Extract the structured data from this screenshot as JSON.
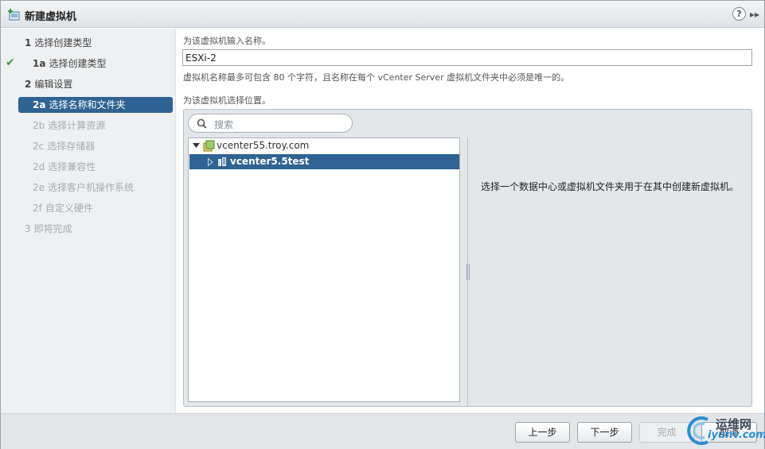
{
  "window": {
    "title": "新建虚拟机",
    "help_label": "?",
    "expand_label": "▸▸"
  },
  "nav": {
    "steps": [
      {
        "num": "1",
        "label": "选择创建类型",
        "state": "normal"
      },
      {
        "num": "1a",
        "label": "选择创建类型",
        "state": "completed"
      },
      {
        "num": "2",
        "label": "编辑设置",
        "state": "normal"
      },
      {
        "num": "2a",
        "label": "选择名称和文件夹",
        "state": "active"
      },
      {
        "num": "2b",
        "label": "选择计算资源",
        "state": "disabled"
      },
      {
        "num": "2c",
        "label": "选择存储器",
        "state": "disabled"
      },
      {
        "num": "2d",
        "label": "选择兼容性",
        "state": "disabled"
      },
      {
        "num": "2e",
        "label": "选择客户机操作系统",
        "state": "disabled"
      },
      {
        "num": "2f",
        "label": "自定义硬件",
        "state": "disabled"
      },
      {
        "num": "3",
        "label": "即将完成",
        "state": "disabled"
      }
    ]
  },
  "content": {
    "name_prompt": "为该虚拟机输入名称。",
    "name_value": "ESXi-2",
    "name_hint": "虚拟机名称最多可包含 80 个字符，且名称在每个 vCenter Server 虚拟机文件夹中必须是唯一的。",
    "location_prompt": "为该虚拟机选择位置。",
    "search_placeholder": "搜索",
    "tree": [
      {
        "label": "vcenter55.troy.com",
        "expanded": true,
        "icon": "vcenter-icon"
      },
      {
        "label": "vcenter5.5test",
        "expanded": false,
        "selected": true,
        "icon": "datacenter-icon"
      }
    ],
    "info_text": "选择一个数据中心或虚拟机文件夹用于在其中创建新虚拟机。"
  },
  "footer": {
    "back_label": "上一步",
    "next_label": "下一步",
    "finish_label": "完成",
    "cancel_label": "取消"
  },
  "watermark": {
    "line1": "运维网",
    "line2": "iyunv.com"
  },
  "colors": {
    "accent": "#2f6393",
    "check": "#3f9a3a"
  }
}
